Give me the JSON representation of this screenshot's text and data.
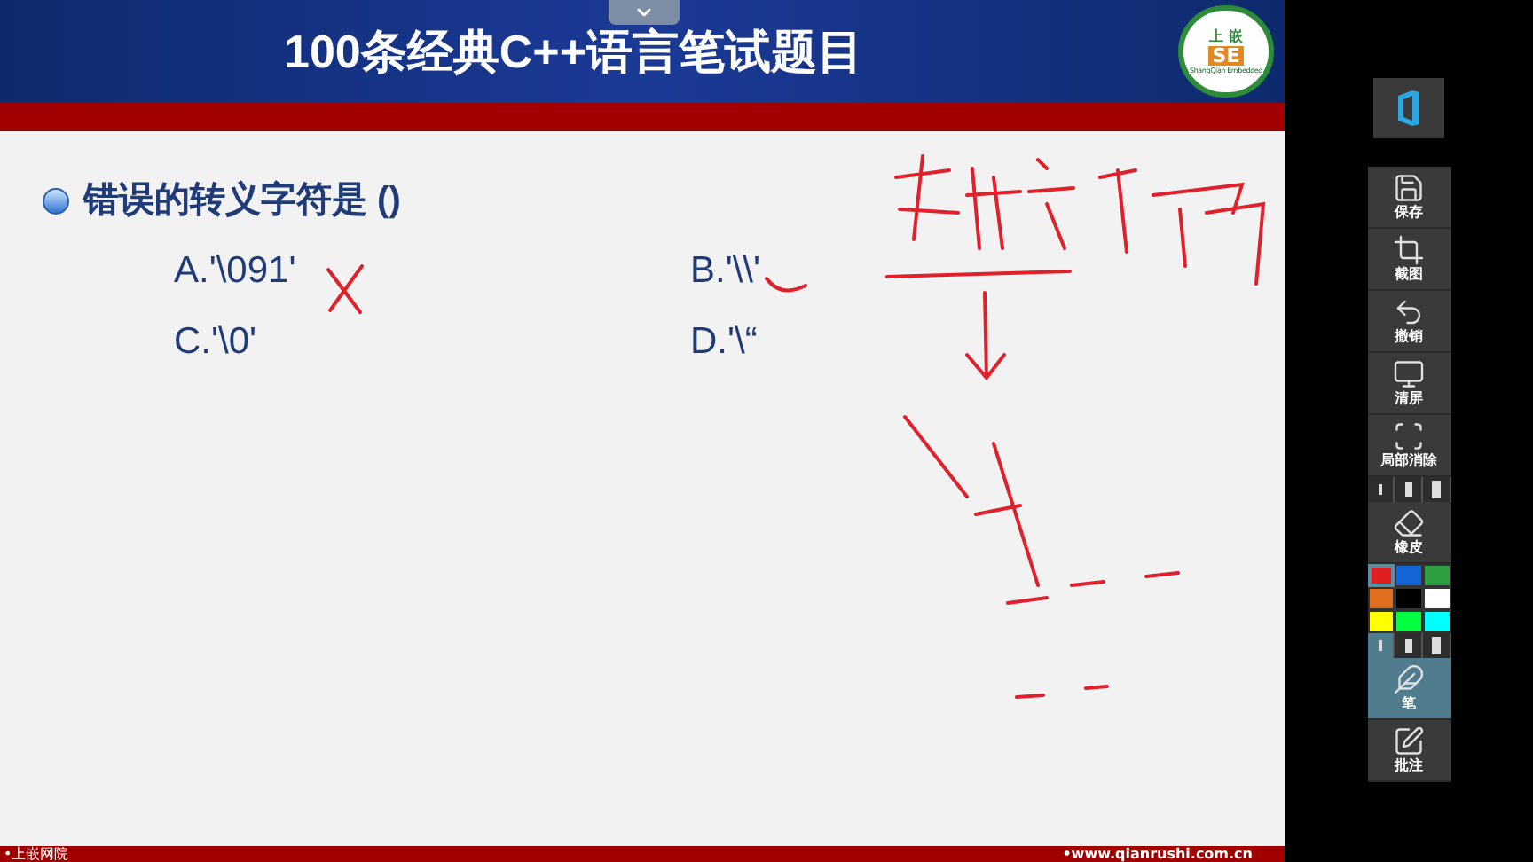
{
  "slide": {
    "title": "100条经典C++语言笔试题目",
    "logo": {
      "top": "上 嵌",
      "mark": "SE",
      "ring": "ShangQian Embedded"
    },
    "question": "错误的转义字符是 ()",
    "options": [
      {
        "label": "A.'\\091'"
      },
      {
        "label": "B.'\\\\'"
      },
      {
        "label": "C.'\\0'"
      },
      {
        "label": "D.'\\“"
      }
    ],
    "footer": {
      "left": "•上嵌网院",
      "right": "•www.qianrushi.com.cn"
    }
  },
  "toolbar": [
    {
      "kind": "button",
      "label": "保存",
      "selected": false
    },
    {
      "kind": "button",
      "label": "截图",
      "selected": false
    },
    {
      "kind": "button",
      "label": "撤销",
      "selected": false
    },
    {
      "kind": "button",
      "label": "清屏",
      "selected": false
    },
    {
      "kind": "button",
      "label": "局部消除",
      "selected": false
    },
    {
      "kind": "sizes",
      "sizes": [
        {
          "selected": false
        },
        {
          "selected": false
        },
        {
          "selected": false
        }
      ]
    },
    {
      "kind": "button",
      "label": "橡皮",
      "selected": false
    },
    {
      "kind": "colors",
      "colors": [
        {
          "color": "#e02020",
          "selected": true
        },
        {
          "color": "#1565d8",
          "selected": false
        },
        {
          "color": "#2ea043",
          "selected": false
        },
        {
          "color": "#e07020",
          "selected": false
        },
        {
          "color": "#000000",
          "selected": false
        },
        {
          "color": "#ffffff",
          "selected": false
        },
        {
          "color": "#ffff00",
          "selected": false
        },
        {
          "color": "#00ff40",
          "selected": false
        },
        {
          "color": "#00ffff",
          "selected": false
        }
      ]
    },
    {
      "kind": "sizes",
      "sizes": [
        {
          "selected": true
        },
        {
          "selected": false
        },
        {
          "selected": false
        }
      ]
    },
    {
      "kind": "button",
      "label": "笔",
      "selected": true
    },
    {
      "kind": "button",
      "label": "批注",
      "selected": false
    }
  ]
}
